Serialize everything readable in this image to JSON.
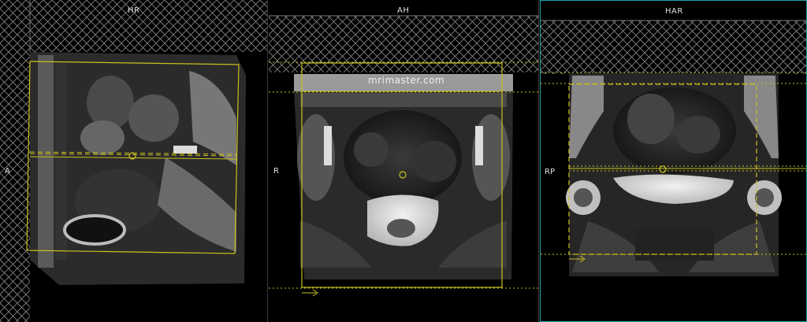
{
  "watermark": "mrimaster.com",
  "viewports": [
    {
      "id": "sagittal",
      "top_label": "HR",
      "side_label": "A",
      "active": false
    },
    {
      "id": "axial",
      "top_label": "AH",
      "side_label": "R",
      "active": false
    },
    {
      "id": "coronal",
      "top_label": "HAR",
      "side_label": "RP",
      "active": true
    }
  ],
  "colors": {
    "accent": "#1fa7ad",
    "planning": "#c8c020",
    "background": "#000000",
    "divider": "#3a3a3a"
  }
}
